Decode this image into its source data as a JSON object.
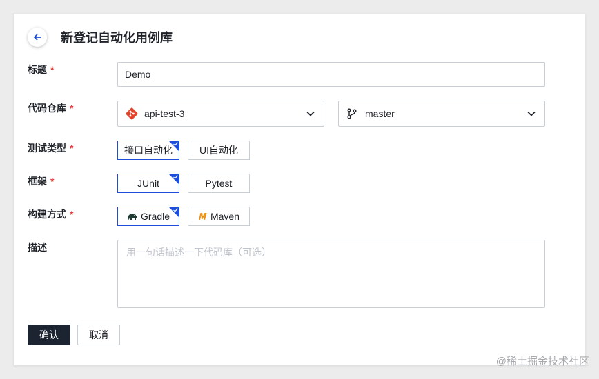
{
  "header": {
    "title": "新登记自动化用例库"
  },
  "form": {
    "title_field": {
      "label": "标题",
      "required_mark": "*",
      "value": "Demo"
    },
    "repo_field": {
      "label": "代码仓库",
      "required_mark": "*",
      "repo_value": "api-test-3",
      "branch_value": "master"
    },
    "test_type": {
      "label": "测试类型",
      "required_mark": "*",
      "options": [
        "接口自动化",
        "UI自动化"
      ],
      "selected": "接口自动化"
    },
    "framework": {
      "label": "框架",
      "required_mark": "*",
      "options": [
        "JUnit",
        "Pytest"
      ],
      "selected": "JUnit"
    },
    "build_method": {
      "label": "构建方式",
      "required_mark": "*",
      "options": [
        "Gradle",
        "Maven"
      ],
      "selected": "Gradle"
    },
    "description": {
      "label": "描述",
      "placeholder": "用一句话描述一下代码库（可选）"
    }
  },
  "actions": {
    "confirm_label": "确认",
    "cancel_label": "取消"
  },
  "watermark": "@稀土掘金技术社区",
  "colors": {
    "accent": "#1d4ed8",
    "primary_button": "#1b2430",
    "required": "#e5383b",
    "git": "#e24329",
    "maven": "#f29111"
  }
}
